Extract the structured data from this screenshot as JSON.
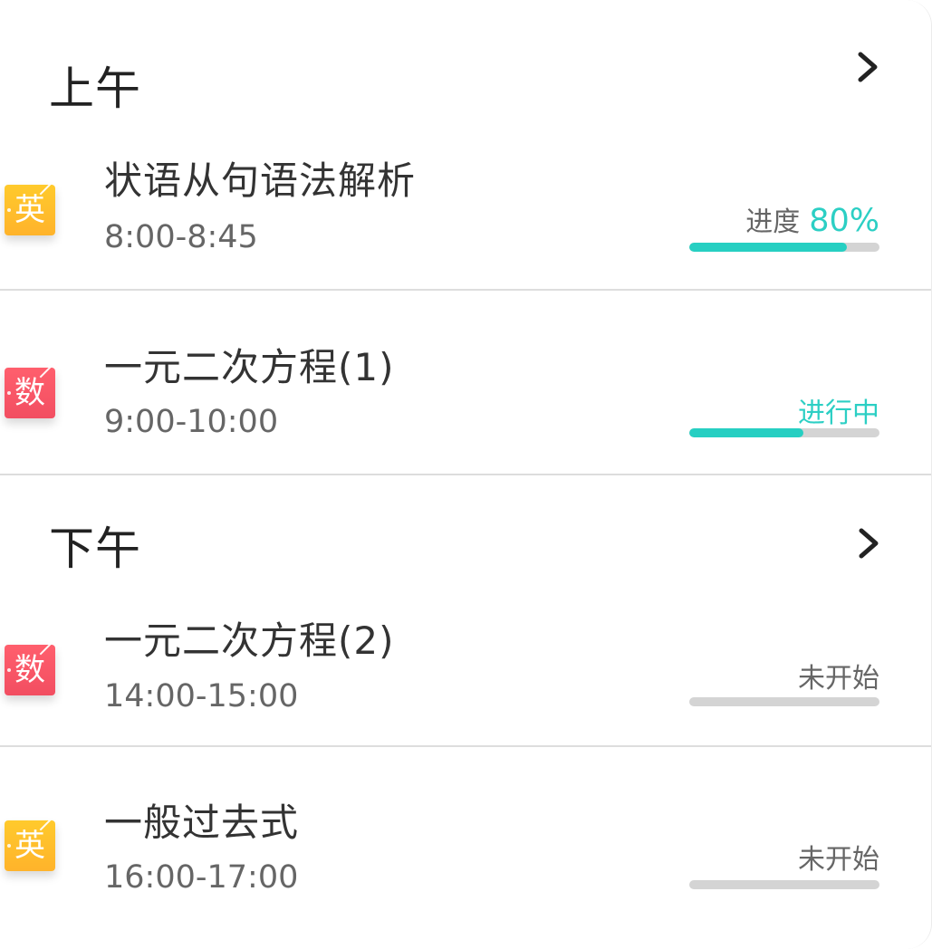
{
  "sections": [
    {
      "title": "上午",
      "icon": "chevron-right-icon",
      "items": [
        {
          "subject": "英",
          "subject_color": "#ffc12b",
          "title": "状语从句语法解析",
          "time": "8:00-8:45",
          "status_label": "进度",
          "status_percent": "80%",
          "progress": 0.83,
          "status_type": "progress"
        },
        {
          "subject": "数",
          "subject_color": "#f75667",
          "title": "一元二次方程(1)",
          "time": "9:00-10:00",
          "status_label": "进行中",
          "progress": 0.6,
          "status_type": "active"
        }
      ]
    },
    {
      "title": "下午",
      "icon": "chevron-right-icon",
      "items": [
        {
          "subject": "数",
          "subject_color": "#f75667",
          "title": "一元二次方程(2)",
          "time": "14:00-15:00",
          "status_label": "未开始",
          "progress": 0,
          "status_type": "pending"
        },
        {
          "subject": "英",
          "subject_color": "#ffc12b",
          "title": "一般过去式",
          "time": "16:00-17:00",
          "status_label": "未开始",
          "progress": 0,
          "status_type": "pending"
        }
      ]
    }
  ],
  "colors": {
    "accent": "#2ccfc4",
    "track": "#d4d4d4",
    "divider": "#dddddd"
  }
}
